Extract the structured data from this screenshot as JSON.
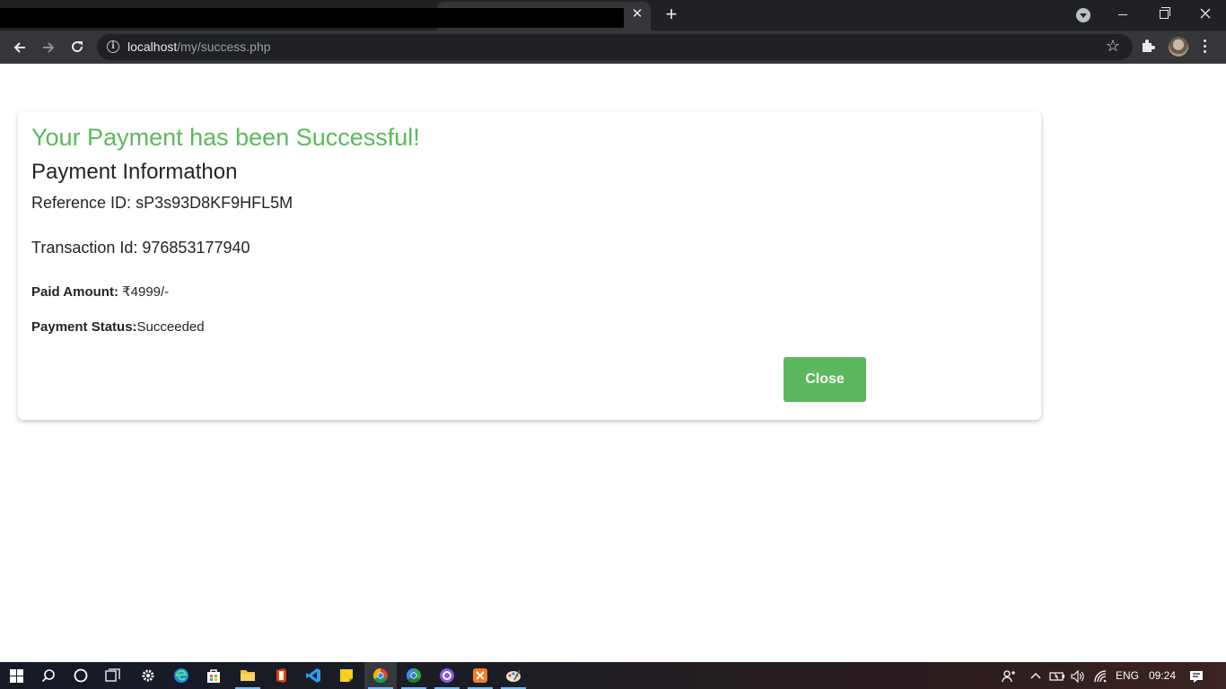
{
  "browser": {
    "tab_close_glyph": "✕",
    "new_tab_glyph": "+",
    "url_host": "localhost",
    "url_path": "/my/success.php",
    "info_glyph": "i",
    "star_glyph": "☆"
  },
  "page": {
    "success_title": "Your Payment has been Successful!",
    "info_heading": "Payment Informathon",
    "reference_label": "Reference ID:",
    "reference_value": " sP3s93D8KF9HFL5M",
    "transaction_label": "Transaction Id:",
    "transaction_value": " 976853177940",
    "amount_label": "Paid Amount:",
    "amount_value": " ₹4999/-",
    "status_label": "Payment Status:",
    "status_value": "Succeeded",
    "close_button": "Close"
  },
  "colors": {
    "success_green": "#5cb85c",
    "text_dark": "#212529",
    "chrome_dark": "#202124",
    "chrome_toolbar": "#35363a"
  },
  "taskbar": {
    "apps": [
      "start-icon",
      "search-icon",
      "cortana-icon",
      "task-view-icon",
      "settings-icon",
      "edge-icon",
      "store-icon",
      "file-explorer-icon",
      "office-icon",
      "vscode-icon",
      "sticky-notes-icon",
      "chrome-icon",
      "chrome-canary-icon",
      "github-desktop-icon",
      "xampp-icon",
      "paint-icon"
    ],
    "language": "ENG",
    "time": "09:24"
  }
}
